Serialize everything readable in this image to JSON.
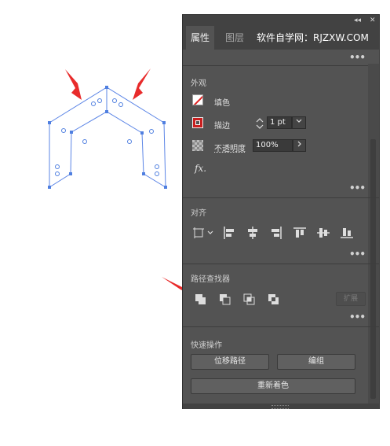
{
  "panel": {
    "tabs": [
      {
        "label": "属性"
      },
      {
        "label": "图层"
      }
    ],
    "watermark": "软件自学网：RJZXW.COM",
    "collapse_glyph": "◂◂",
    "close_glyph": "✕",
    "appearance": {
      "title": "外观",
      "fill_label": "填色",
      "stroke_label": "描边",
      "stroke_weight": "1 pt",
      "opacity_label": "不透明度",
      "opacity_value": "100%",
      "fx_label": "fx."
    },
    "align": {
      "title": "对齐"
    },
    "pathfinder": {
      "title": "路径查找器",
      "expand_label": "扩展"
    },
    "quick_actions": {
      "title": "快速操作",
      "offset_path_label": "位移路径",
      "group_label": "编组",
      "recolor_label": "重新着色"
    }
  },
  "colors": {
    "panel_bg": "#535353",
    "path_stroke": "#4f7fe0",
    "arrow_red": "#e82b2b"
  }
}
